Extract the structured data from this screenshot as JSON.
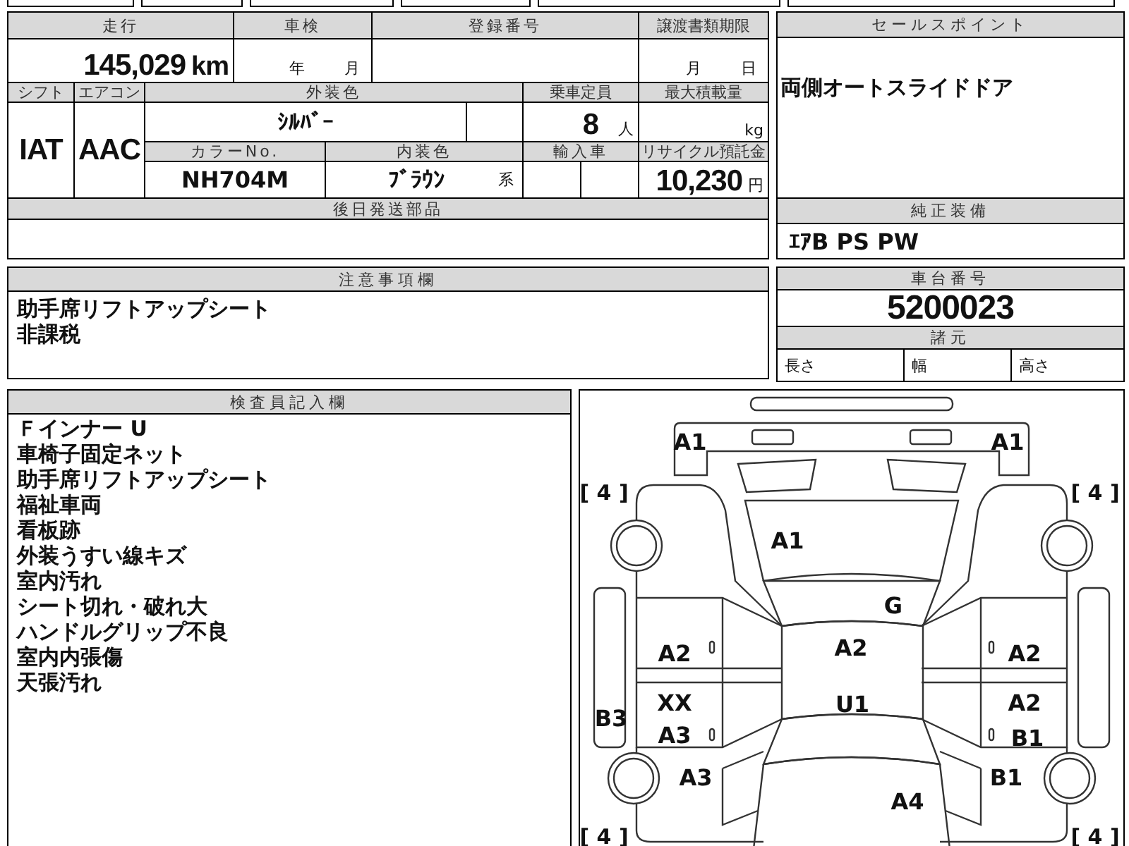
{
  "vehicle_info": {
    "mileage": {
      "label": "走行",
      "value": "145,029",
      "unit": "km"
    },
    "inspection": {
      "label": "車検",
      "year_unit": "年",
      "month_unit": "月"
    },
    "registration_number": {
      "label": "登録番号"
    },
    "transfer_deadline": {
      "label": "譲渡書類期限",
      "month_unit": "月",
      "day_unit": "日"
    },
    "shift": {
      "label": "シフト",
      "value": "IAT"
    },
    "air_conditioner": {
      "label": "エアコン",
      "value": "AAC"
    },
    "exterior_color": {
      "label": "外装色",
      "value": "ｼﾙﾊﾞｰ"
    },
    "capacity": {
      "label": "乗車定員",
      "value": "8",
      "unit": "人"
    },
    "max_load": {
      "label": "最大積載量",
      "unit": "kg"
    },
    "color_number": {
      "label": "カラーNo.",
      "value": "NH704M"
    },
    "interior_color": {
      "label": "内装色",
      "value": "ﾌﾞﾗｳﾝ",
      "suffix": "系"
    },
    "imported": {
      "label": "輸入車"
    },
    "recycle_fee": {
      "label": "リサイクル預託金",
      "value": "10,230",
      "unit": "円"
    },
    "later_parts": {
      "label": "後日発送部品"
    }
  },
  "sales_point": {
    "label": "セールスポイント",
    "text": "両側オートスライドドア"
  },
  "standard_equipment": {
    "label": "純正装備",
    "text": "ｴｱB PS PW"
  },
  "notes": {
    "label": "注意事項欄",
    "lines": [
      "助手席リフトアップシート",
      "非課税"
    ]
  },
  "chassis": {
    "label": "車台番号",
    "value": "5200023"
  },
  "specs": {
    "label": "諸元",
    "items": [
      "長さ",
      "幅",
      "高さ"
    ]
  },
  "inspector_notes": {
    "label": "検査員記入欄",
    "lines": [
      "Ｆインナー U",
      "車椅子固定ネット",
      "助手席リフトアップシート",
      "福祉車両",
      "看板跡",
      "外装うすい線キズ",
      "室内汚れ",
      "シート切れ・破れ大",
      "ハンドルグリップ不良",
      "室内内張傷",
      "天張汚れ"
    ]
  },
  "damage_diagram": {
    "marks": [
      {
        "kind": "code",
        "text": "A1"
      },
      {
        "kind": "code",
        "text": "A1"
      },
      {
        "kind": "tire",
        "text": "[ 4 ]"
      },
      {
        "kind": "tire",
        "text": "[ 4 ]"
      },
      {
        "kind": "code",
        "text": "A1"
      },
      {
        "kind": "code",
        "text": "G"
      },
      {
        "kind": "code",
        "text": "A2"
      },
      {
        "kind": "code",
        "text": "A2"
      },
      {
        "kind": "code",
        "text": "A2"
      },
      {
        "kind": "code",
        "text": "XX"
      },
      {
        "kind": "code",
        "text": "U1"
      },
      {
        "kind": "code",
        "text": "A2"
      },
      {
        "kind": "code",
        "text": "B3"
      },
      {
        "kind": "code",
        "text": "A3"
      },
      {
        "kind": "code",
        "text": "B1"
      },
      {
        "kind": "code",
        "text": "A3"
      },
      {
        "kind": "code",
        "text": "B1"
      },
      {
        "kind": "code",
        "text": "A4"
      },
      {
        "kind": "tire",
        "text": "[ 4 ]"
      },
      {
        "kind": "tire",
        "text": "[ 4 ]"
      }
    ]
  }
}
